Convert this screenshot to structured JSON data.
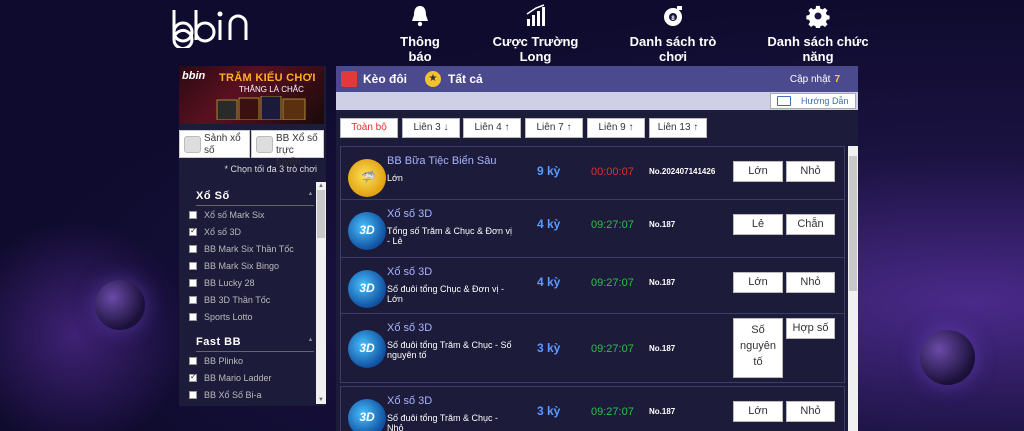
{
  "header": {
    "logo_text": "bbin",
    "nav": [
      {
        "label": "Thông báo",
        "icon": "bell-icon"
      },
      {
        "label": "Cược Trường Long",
        "icon": "bar-chart-icon"
      },
      {
        "label": "Danh sách trò chơi",
        "icon": "game-ball-icon"
      },
      {
        "label": "Danh sách chức năng",
        "icon": "gear-icon"
      }
    ]
  },
  "sidebar": {
    "banner": {
      "logo": "bbin",
      "title": "TRĂM KIỂU CHƠI",
      "subtitle": "THẮNG LÀ CHẮC"
    },
    "halls": [
      {
        "label": "Sảnh xổ số",
        "icon": "home-icon"
      },
      {
        "label": "BB Xổ số trực tuyến",
        "icon": "monitor-icon"
      }
    ],
    "pick_note": "* Chọn tối đa 3 trò chơi",
    "categories": [
      {
        "title": "Xổ Số",
        "items": [
          {
            "label": "Xổ số Mark Six",
            "checked": false
          },
          {
            "label": "Xổ số 3D",
            "checked": true
          },
          {
            "label": "BB Mark Six Thần Tốc",
            "checked": false
          },
          {
            "label": "BB Mark Six Bingo",
            "checked": false
          },
          {
            "label": "BB Lucky 28",
            "checked": false
          },
          {
            "label": "BB 3D Thần Tốc",
            "checked": false
          },
          {
            "label": "Sports Lotto",
            "checked": false
          }
        ]
      },
      {
        "title": "Fast BB",
        "items": [
          {
            "label": "BB Plinko",
            "checked": false
          },
          {
            "label": "BB Mario Ladder",
            "checked": true
          },
          {
            "label": "BB Xổ Số Bi-a",
            "checked": false
          }
        ]
      }
    ]
  },
  "main": {
    "tabs": [
      {
        "label": "Kèo đôi",
        "icon": "bar-chart-red-icon"
      },
      {
        "label": "Tất cả",
        "icon": "star-icon"
      }
    ],
    "update_label": "Cập nhật",
    "update_count": "7",
    "guide_label": "Hướng Dẫn",
    "filters": [
      {
        "label": "Toàn bộ",
        "active": true
      },
      {
        "label": "Liên 3 ↓",
        "active": false
      },
      {
        "label": "Liên 4 ↑",
        "active": false
      },
      {
        "label": "Liên 7 ↑",
        "active": false
      },
      {
        "label": "Liên 9 ↑",
        "active": false
      },
      {
        "label": "Liên 13 ↑",
        "active": false
      }
    ],
    "rows": [
      {
        "name": "BB Bữa Tiệc Biển Sâu",
        "desc": "Lớn",
        "period": "9 kỳ",
        "time": "00:00:07",
        "time_color": "#e03030",
        "no": "No.202407141426",
        "bets": [
          "Lớn",
          "Nhỏ"
        ],
        "icon": "shark-icon"
      },
      {
        "name": "Xổ số 3D",
        "desc": "Tổng số Trăm & Chục & Đơn vị - Lẻ",
        "period": "4 kỳ",
        "time": "09:27:07",
        "time_color": "#2fbf4a",
        "no": "No.187",
        "bets": [
          "Lẻ",
          "Chẵn"
        ],
        "icon": "3d-lottery-icon"
      },
      {
        "name": "Xổ số 3D",
        "desc": "Số đuôi tổng Chục & Đơn vị - Lớn",
        "period": "4 kỳ",
        "time": "09:27:07",
        "time_color": "#2fbf4a",
        "no": "No.187",
        "bets": [
          "Lớn",
          "Nhỏ"
        ],
        "icon": "3d-lottery-icon"
      },
      {
        "name": "Xổ số 3D",
        "desc": "Số đuôi tổng Trăm & Chục - Số nguyên tố",
        "period": "3 kỳ",
        "time": "09:27:07",
        "time_color": "#2fbf4a",
        "no": "No.187",
        "bets": [
          "Số nguyên tố",
          "Hợp số"
        ],
        "icon": "3d-lottery-icon"
      },
      {
        "name": "Xổ số 3D",
        "desc": "Số đuôi tổng Trăm & Chục - Nhỏ",
        "period": "3 kỳ",
        "time": "09:27:07",
        "time_color": "#2fbf4a",
        "no": "No.187",
        "bets": [
          "Lớn",
          "Nhỏ"
        ],
        "icon": "3d-lottery-icon"
      }
    ]
  }
}
